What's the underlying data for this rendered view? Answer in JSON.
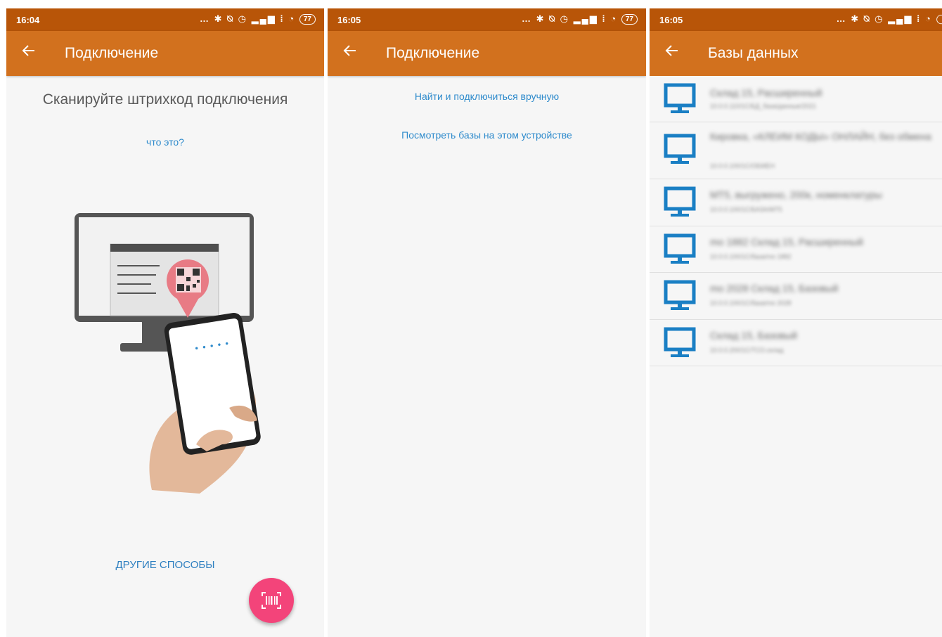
{
  "screens": [
    {
      "status": {
        "time": "16:04",
        "battery": "77"
      },
      "appbar": {
        "title": "Подключение"
      },
      "heading": "Сканируйте штрихкод подключения",
      "what_link": "что это?",
      "other_ways": "ДРУГИЕ СПОСОБЫ",
      "fab_icon": "barcode-scan-icon"
    },
    {
      "status": {
        "time": "16:05",
        "battery": "77"
      },
      "appbar": {
        "title": "Подключение"
      },
      "find_manual": "Найти и подключиться вручную",
      "view_local": "Посмотреть базы на этом устройстве"
    },
    {
      "status": {
        "time": "16:05"
      },
      "appbar": {
        "title": "Базы данных"
      },
      "databases": [
        {
          "name": "Склад 15, Расширенный",
          "address": "10.0.0.110/1C/БД_база/данные/2021"
        },
        {
          "name": "Кировка, «КЛЕИМ КОДЫ» ОНЛАЙН, без обмена",
          "address": "10.0.0.100/1С/ОБМЕН"
        },
        {
          "name": "МТ5, выгружено, 200к, номенклатуры",
          "address": "10.0.0.100/1С/БАЗА/МТ5"
        },
        {
          "name": "mo 1882 Склад 15, Расширенный",
          "address": "10.0.0.100/1С/база/mo 1882"
        },
        {
          "name": "mo 2028 Склад 15, Базовый",
          "address": "10.0.0.100/1С/база/mo 2028"
        },
        {
          "name": "Склад 15, Базовый",
          "address": "10.0.0.200/1С/ТСО.склад"
        }
      ]
    }
  ],
  "colors": {
    "status_bar": "#b85508",
    "app_bar": "#d2711e",
    "link": "#2f8bcc",
    "fab": "#f3447a",
    "monitor_icon": "#1a7fc4"
  }
}
